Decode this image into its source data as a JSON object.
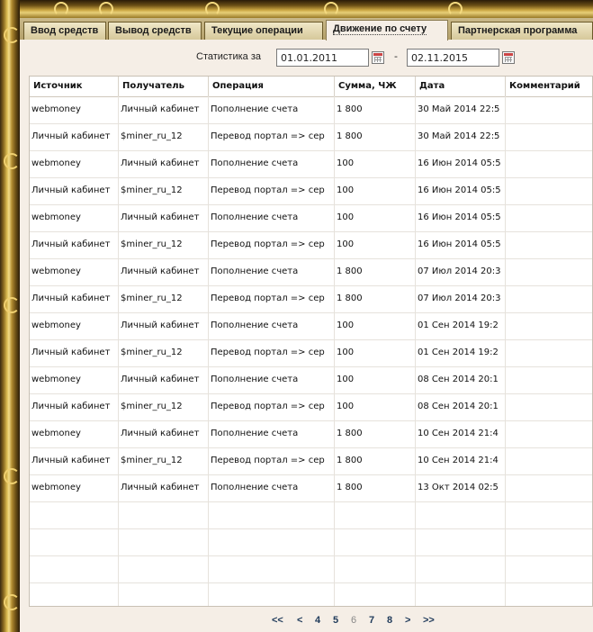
{
  "tabs": [
    {
      "label": "Ввод средств"
    },
    {
      "label": "Вывод средств"
    },
    {
      "label": "Текущие операции"
    },
    {
      "label": "Движение по счету"
    },
    {
      "label": "Партнерская программа"
    }
  ],
  "stats": {
    "label": "Статистика за",
    "date_from": "01.01.2011",
    "separator": "-",
    "date_to": "02.11.2015"
  },
  "table": {
    "headers": [
      "Источник",
      "Получатель",
      "Операция",
      "Сумма, ЧЖ",
      "Дата",
      "Комментарий"
    ],
    "rows": [
      [
        "webmoney",
        "Личный кабинет",
        "Пополнение счета",
        "1 800",
        "30 Май 2014 22:5",
        ""
      ],
      [
        "Личный кабинет",
        "$miner_ru_12",
        "Перевод портал => сер",
        "1 800",
        "30 Май 2014 22:5",
        ""
      ],
      [
        "webmoney",
        "Личный кабинет",
        "Пополнение счета",
        "100",
        "16 Июн 2014 05:5",
        ""
      ],
      [
        "Личный кабинет",
        "$miner_ru_12",
        "Перевод портал => сер",
        "100",
        "16 Июн 2014 05:5",
        ""
      ],
      [
        "webmoney",
        "Личный кабинет",
        "Пополнение счета",
        "100",
        "16 Июн 2014 05:5",
        ""
      ],
      [
        "Личный кабинет",
        "$miner_ru_12",
        "Перевод портал => сер",
        "100",
        "16 Июн 2014 05:5",
        ""
      ],
      [
        "webmoney",
        "Личный кабинет",
        "Пополнение счета",
        "1 800",
        "07 Июл 2014 20:3",
        ""
      ],
      [
        "Личный кабинет",
        "$miner_ru_12",
        "Перевод портал => сер",
        "1 800",
        "07 Июл 2014 20:3",
        ""
      ],
      [
        "webmoney",
        "Личный кабинет",
        "Пополнение счета",
        "100",
        "01 Сен 2014 19:2",
        ""
      ],
      [
        "Личный кабинет",
        "$miner_ru_12",
        "Перевод портал => сер",
        "100",
        "01 Сен 2014 19:2",
        ""
      ],
      [
        "webmoney",
        "Личный кабинет",
        "Пополнение счета",
        "100",
        "08 Сен 2014 20:1",
        ""
      ],
      [
        "Личный кабинет",
        "$miner_ru_12",
        "Перевод портал => сер",
        "100",
        "08 Сен 2014 20:1",
        ""
      ],
      [
        "webmoney",
        "Личный кабинет",
        "Пополнение счета",
        "1 800",
        "10 Сен 2014 21:4",
        ""
      ],
      [
        "Личный кабинет",
        "$miner_ru_12",
        "Перевод портал => сер",
        "1 800",
        "10 Сен 2014 21:4",
        ""
      ],
      [
        "webmoney",
        "Личный кабинет",
        "Пополнение счета",
        "1 800",
        "13 Окт 2014 02:5",
        ""
      ]
    ],
    "empty_rows": 4
  },
  "pager": {
    "first": "<<",
    "prev": "<",
    "pages": [
      "4",
      "5",
      "6",
      "7",
      "8"
    ],
    "current": "6",
    "next": ">",
    "last": ">>"
  },
  "icons": {
    "calendar": "calendar-icon"
  }
}
